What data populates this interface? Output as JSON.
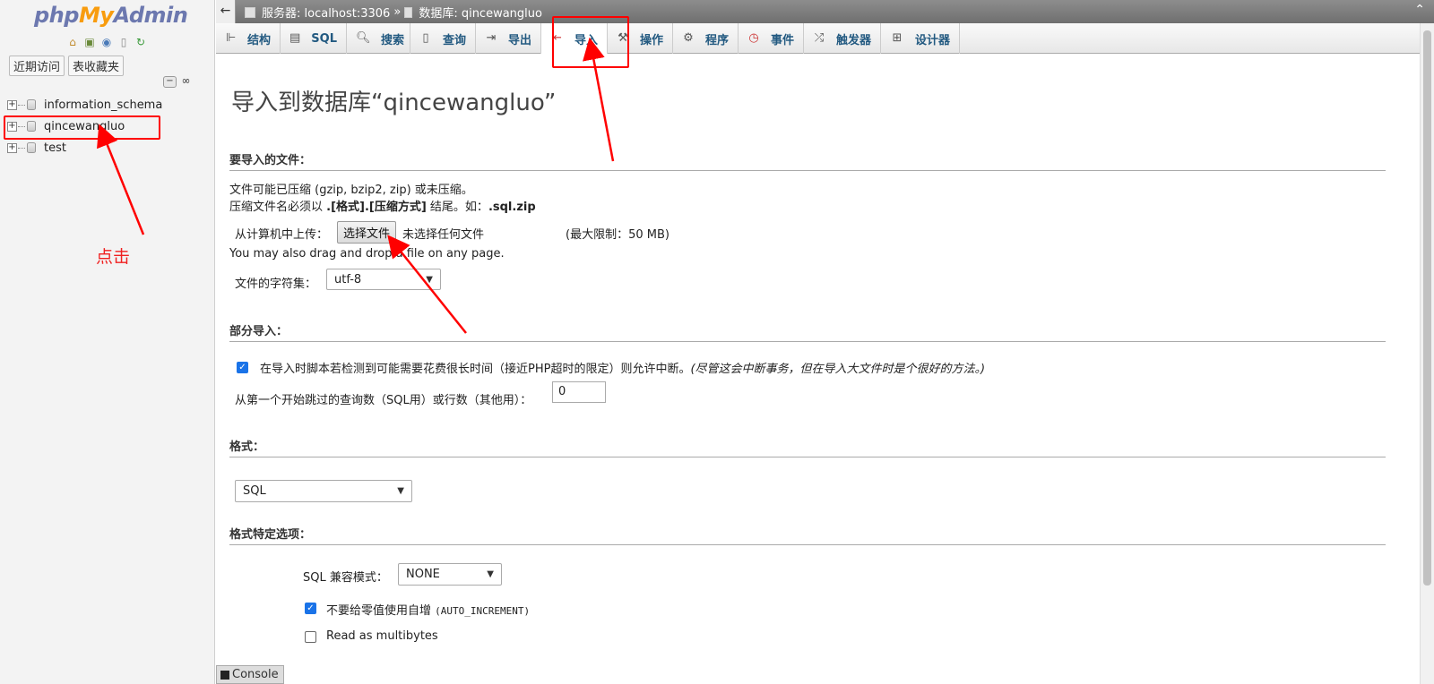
{
  "nav": {
    "logo": {
      "php": "php",
      "my": "My",
      "admin": "Admin"
    },
    "icons": [
      "home-icon",
      "exit-icon",
      "help-icon",
      "docs-icon",
      "reload-icon"
    ],
    "recent_label": "近期访问",
    "favorites_label": "表收藏夹",
    "databases": [
      {
        "name": "information_schema"
      },
      {
        "name": "qincewangluo"
      },
      {
        "name": "test"
      }
    ],
    "annotation": "点击"
  },
  "topbar": {
    "server_label": "服务器: localhost:3306",
    "separator": "»",
    "database_label": "数据库: qincewangluo"
  },
  "tabs": [
    {
      "label": "结构",
      "icon": "structure-icon"
    },
    {
      "label": "SQL",
      "icon": "sql-icon"
    },
    {
      "label": "搜索",
      "icon": "search-icon"
    },
    {
      "label": "查询",
      "icon": "query-icon"
    },
    {
      "label": "导出",
      "icon": "export-icon"
    },
    {
      "label": "导入",
      "icon": "import-icon",
      "active": true
    },
    {
      "label": "操作",
      "icon": "wrench-icon"
    },
    {
      "label": "程序",
      "icon": "routines-icon"
    },
    {
      "label": "事件",
      "icon": "clock-icon"
    },
    {
      "label": "触发器",
      "icon": "triggers-icon"
    },
    {
      "label": "设计器",
      "icon": "designer-icon"
    }
  ],
  "main": {
    "title": "导入到数据库“qincewangluo”",
    "file_section": {
      "heading": "要导入的文件：",
      "compress_note": "文件可能已压缩 (gzip, bzip2, zip) 或未压缩。",
      "name_note_prefix": "压缩文件名必须以 ",
      "name_note_format": ".[格式].[压缩方式]",
      "name_note_middle": " 结尾。如：",
      "name_note_example": ".sql.zip",
      "upload_label": "从计算机中上传：",
      "choose_file_button": "选择文件",
      "no_file_text": "未选择任何文件",
      "max_limit": "(最大限制：50 MB)",
      "drag_drop_note": "You may also drag and drop a file on any page.",
      "charset_label": "文件的字符集：",
      "charset_value": "utf-8"
    },
    "partial_section": {
      "heading": "部分导入：",
      "interrupt_text": "在导入时脚本若检测到可能需要花费很长时间（接近PHP超时的限定）则允许中断。",
      "interrupt_note": "(尽管这会中断事务，但在导入大文件时是个很好的方法。)",
      "interrupt_checked": true,
      "skip_label": "从第一个开始跳过的查询数（SQL用）或行数（其他用）：",
      "skip_value": "0"
    },
    "format_section": {
      "heading": "格式：",
      "format_value": "SQL"
    },
    "format_options_section": {
      "heading": "格式特定选项：",
      "compat_label": "SQL 兼容模式：",
      "compat_value": "NONE",
      "auto_inc_label": "不要给零值使用自增",
      "auto_inc_code": "(AUTO_INCREMENT)",
      "auto_inc_checked": true,
      "multibytes_label": "Read as multibytes",
      "multibytes_checked": false
    }
  },
  "console_label": "Console",
  "colors": {
    "annotation_red": "#ff0000",
    "link_blue": "#235a81",
    "checkbox_blue": "#1a73e8"
  }
}
